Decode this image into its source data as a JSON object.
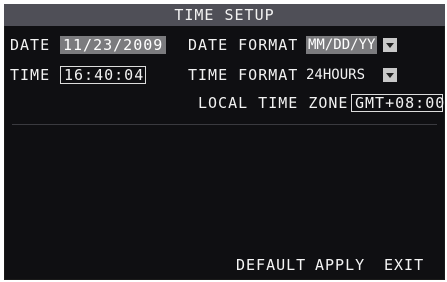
{
  "window": {
    "title": "TIME SETUP"
  },
  "date": {
    "label": "DATE",
    "value": "11/23/2009"
  },
  "time": {
    "label": "TIME",
    "value": "16:40:04"
  },
  "date_format": {
    "label": "DATE FORMAT",
    "value": "MM/DD/YY"
  },
  "time_format": {
    "label": "TIME FORMAT",
    "value": "24HOURS"
  },
  "time_zone": {
    "label": "LOCAL TIME ZONE",
    "value": "GMT+08:00"
  },
  "buttons": {
    "default": "DEFAULT",
    "apply": "APPLY",
    "exit": "EXIT"
  },
  "colors": {
    "background": "#0f0f12",
    "title_bar": "#4f4f57",
    "selected_field": "#7b7b7e",
    "text": "#f2f2f2"
  },
  "icons": {
    "dropdown": "chevron-down-icon"
  }
}
